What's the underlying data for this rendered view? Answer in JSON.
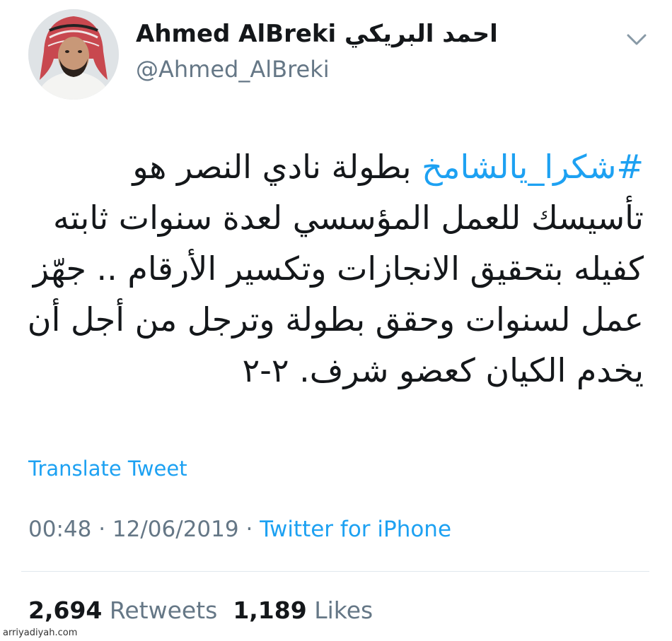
{
  "user": {
    "display_name": "Ahmed AlBreki احمد البريكي",
    "handle": "@Ahmed_AlBreki",
    "avatar_icon": "profile-photo"
  },
  "tweet": {
    "hashtag": "#شكرا_يالشامخ",
    "line1_rest": " بطولة نادي النصر هو",
    "line2": "تأسيسك للعمل المؤسسي لعدة سنوات ثابته",
    "line3": "كفيله بتحقيق الانجازات وتكسير الأرقام .. جهّز",
    "line4": "عمل لسنوات وحقق بطولة وترجل من أجل أن",
    "line5": "يخدم الكيان كعضو  شرف. ٢-٢"
  },
  "translate_label": "Translate Tweet",
  "meta": {
    "time": "00:48",
    "separator": " · ",
    "date": "12/06/2019",
    "source": "Twitter for iPhone"
  },
  "stats": {
    "retweets_count": "2,694",
    "retweets_label": "Retweets",
    "likes_count": "1,189",
    "likes_label": "Likes"
  },
  "watermark": "arriyadiyah.com",
  "colors": {
    "accent": "#1da1f2",
    "muted": "#657786",
    "text": "#14171a"
  }
}
